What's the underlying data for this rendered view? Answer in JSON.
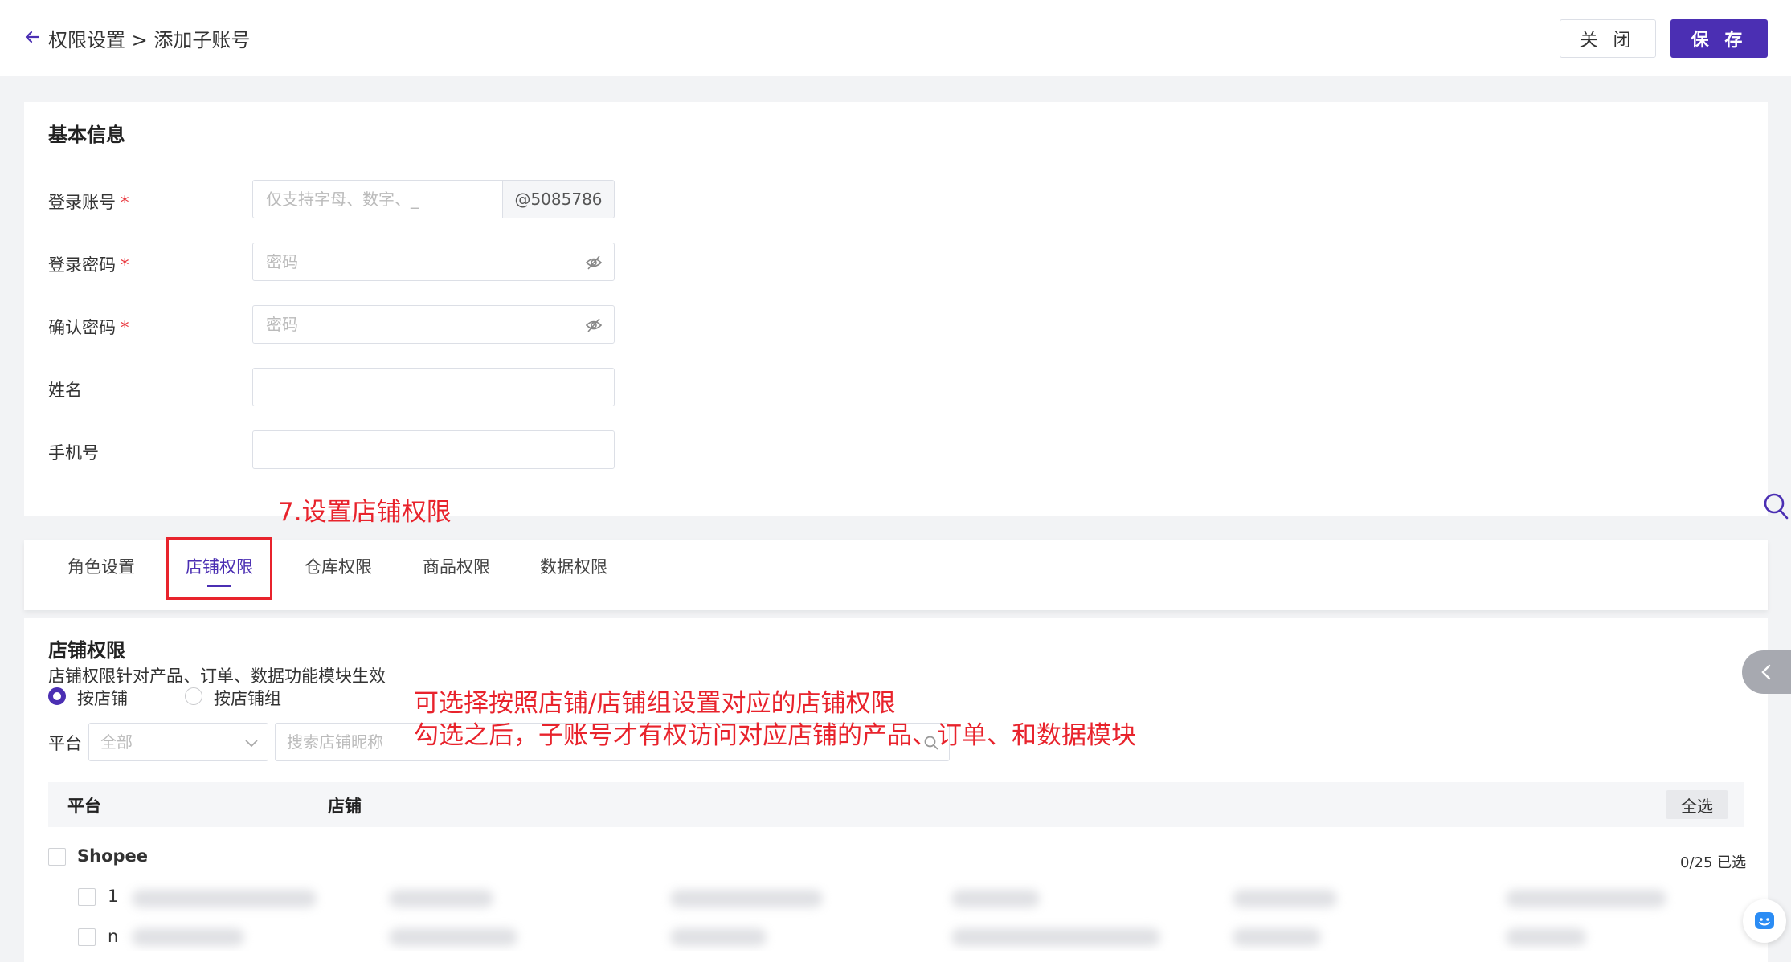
{
  "header": {
    "breadcrumb": "权限设置 > 添加子账号",
    "close_label": "关 闭",
    "save_label": "保 存"
  },
  "basic_info": {
    "title": "基本信息",
    "fields": [
      {
        "label": "登录账号",
        "required": "*",
        "placeholder": "仅支持字母、数字、_",
        "suffix": "@5085786"
      },
      {
        "label": "登录密码",
        "required": "*",
        "placeholder": "密码"
      },
      {
        "label": "确认密码",
        "required": "*",
        "placeholder": "密码"
      },
      {
        "label": "姓名",
        "placeholder": ""
      },
      {
        "label": "手机号",
        "placeholder": ""
      }
    ]
  },
  "annotations": {
    "step7": "7.设置店铺权限",
    "note_line1": "可选择按照店铺/店铺组设置对应的店铺权限",
    "note_line2": "勾选之后，子账号才有权访问对应店铺的产品、订单、和数据模块"
  },
  "tabs": [
    {
      "label": "角色设置"
    },
    {
      "label": "店铺权限",
      "active": true
    },
    {
      "label": "仓库权限"
    },
    {
      "label": "商品权限"
    },
    {
      "label": "数据权限"
    }
  ],
  "shop_permission": {
    "title": "店铺权限",
    "description": "店铺权限针对产品、订单、数据功能模块生效",
    "radio_by_shop": "按店铺",
    "radio_by_group": "按店铺组",
    "filter_platform_label": "平台",
    "platform_select_value": "全部",
    "search_placeholder": "搜索店铺昵称",
    "col_platform": "平台",
    "col_shop": "店铺",
    "select_all_label": "全选",
    "platform_group": "Shopee",
    "selected_count": "0/25 已选",
    "rows": [
      {
        "prefix": "1"
      },
      {
        "prefix": "n"
      }
    ]
  },
  "colors": {
    "primary": "#4b2fb3",
    "annotation": "#e8232c",
    "required": "#e8333a"
  }
}
